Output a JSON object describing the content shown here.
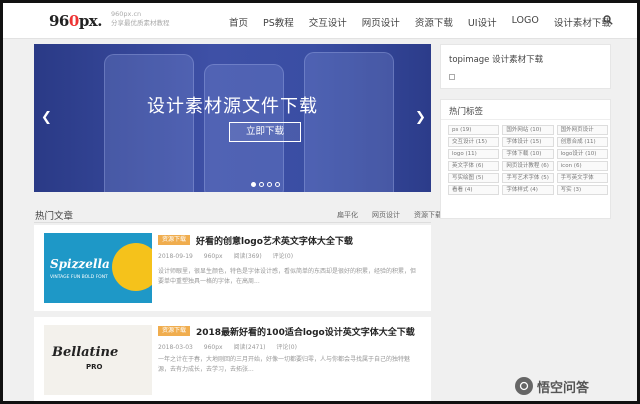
{
  "header": {
    "logo": {
      "main": "96",
      "dot": "0",
      "tail": "px."
    },
    "sub_line1": "960px.cn",
    "sub_line2": "分享最优质素材教程",
    "nav": [
      "首页",
      "PS教程",
      "交互设计",
      "网页设计",
      "资源下载",
      "UI设计",
      "LOGO",
      "设计素材下载"
    ],
    "search_icon": "search-icon"
  },
  "banner": {
    "title": "设计素材源文件下载",
    "button": "立即下载",
    "prev_icon": "chevron-left-icon",
    "next_icon": "chevron-right-icon",
    "dots": [
      true,
      false,
      false,
      false
    ],
    "colors": {
      "from": "#2a3a86",
      "to": "#3e50a6"
    }
  },
  "hot": {
    "title": "热门文章",
    "tags": [
      "扁平化",
      "网页设计",
      "资源下载"
    ]
  },
  "articles": [
    {
      "badge": "资源下载",
      "title": "好看的创意logo艺术英文字体大全下载",
      "date": "2018-09-19",
      "author": "960px",
      "views": "阅读(369)",
      "comments": "评论(0)",
      "excerpt": "设计师眼里，很显生颜色，特色是字体设计感，看似简单的东西却是很好的积累，经验的积累，但要单中重塑独具一格的字体，在高周...",
      "thumb_text1": "Spizzella",
      "thumb_text2": "VINTAGE FUN BOLD FONT"
    },
    {
      "badge": "资源下载",
      "title": "2018最新好看的100适合logo设计英文字体大全下载",
      "date": "2018-03-03",
      "author": "960px",
      "views": "阅读(2471)",
      "comments": "评论(0)",
      "excerpt": "一年之计在于春，大地刚回的三月开始，好像一切都要归零，人与你都会寻找属于自己的独特魅源，去有力成长，去学习，去拓张...",
      "thumb_text1": "Bellatine",
      "thumb_text2": "PRO"
    }
  ],
  "sidebar": {
    "box1_title": "topimage 设计素材下载",
    "box2_title": "热门标签",
    "tags": [
      "ps (19)",
      "国外网站 (10)",
      "国外网页设计",
      "交互设计 (15)",
      "字体设计 (15)",
      "创意合成 (11)",
      "logo (11)",
      "字体下载 (10)",
      "logo设计 (10)",
      "英文字体 (6)",
      "网页设计教程 (6)",
      "icon (6)",
      "写实绘图 (5)",
      "手写艺术字体 (5)",
      "手写英文字体",
      "看看 (4)",
      "字体样式 (4)",
      "写实 (3)"
    ]
  },
  "watermark": {
    "text": "悟空问答"
  }
}
